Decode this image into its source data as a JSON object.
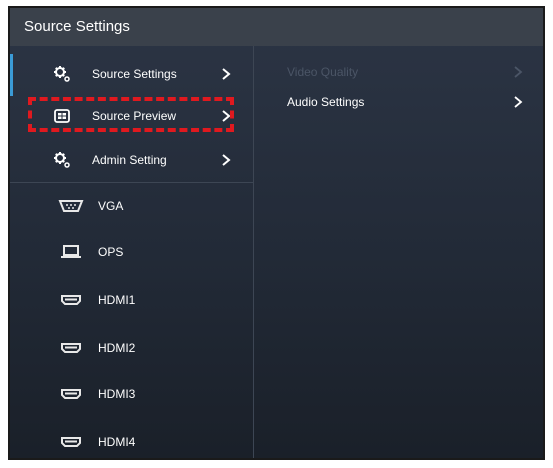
{
  "window": {
    "title": "Source Settings"
  },
  "menu": {
    "items": [
      {
        "label": "Source Settings",
        "icon": "gear-icon"
      },
      {
        "label": "Source Preview",
        "icon": "preview-icon"
      },
      {
        "label": "Admin Setting",
        "icon": "gear-icon"
      }
    ]
  },
  "sources": [
    {
      "label": "VGA",
      "icon": "vga-port-icon"
    },
    {
      "label": "OPS",
      "icon": "laptop-icon"
    },
    {
      "label": "HDMI1",
      "icon": "hdmi-port-icon"
    },
    {
      "label": "HDMI2",
      "icon": "hdmi-port-icon"
    },
    {
      "label": "HDMI3",
      "icon": "hdmi-port-icon"
    },
    {
      "label": "HDMI4",
      "icon": "hdmi-port-icon"
    }
  ],
  "submenu": {
    "items": [
      {
        "label": "Video Quality",
        "enabled": false
      },
      {
        "label": "Audio Settings",
        "enabled": true
      }
    ]
  },
  "colors": {
    "accent": "#3b9bd6",
    "highlight": "#e0191f",
    "titlebar": "#3a414b",
    "disabled_text": "#4b5566"
  }
}
